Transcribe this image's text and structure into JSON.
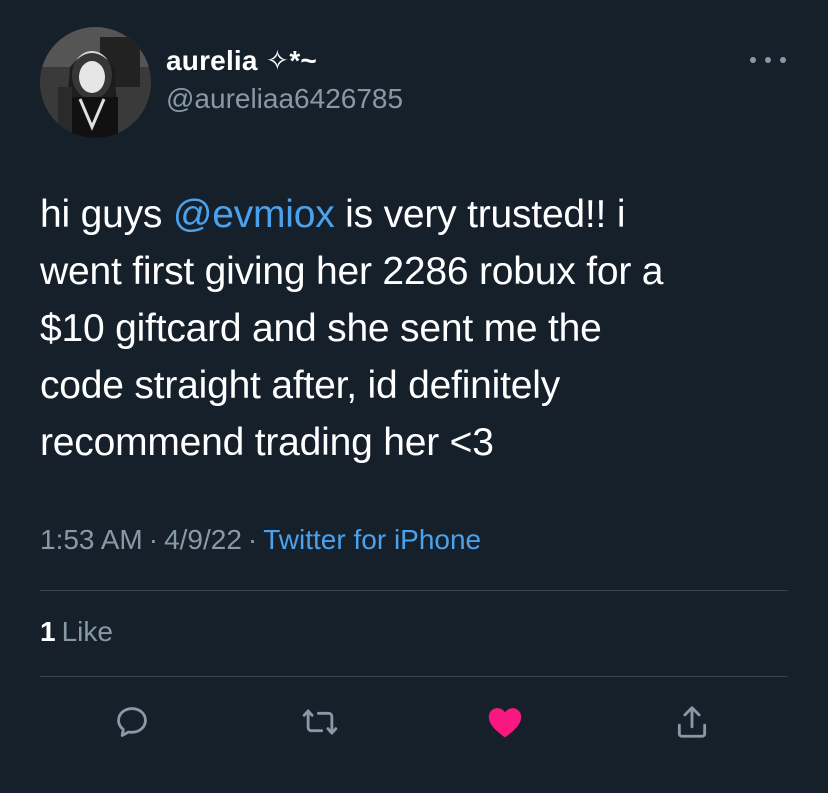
{
  "author": {
    "display_name": "aurelia ✧*~",
    "handle": "@aureliaa6426785"
  },
  "tweet": {
    "lines": [
      {
        "before": "hi guys ",
        "mention": "@evmiox",
        "after": " is very trusted!! i"
      },
      {
        "text": "went first giving her 2286 robux for a"
      },
      {
        "text": "$10 giftcard and she sent me the"
      },
      {
        "text": "code straight after, id definitely"
      },
      {
        "text": "recommend trading her <3"
      }
    ]
  },
  "meta": {
    "time": "1:53 AM",
    "separator": "·",
    "date": "4/9/22",
    "source": "Twitter for iPhone"
  },
  "engagement": {
    "like_count": "1",
    "like_label": "Like"
  },
  "actions": [
    "reply-icon",
    "retweet-icon",
    "like-icon",
    "share-icon"
  ],
  "colors": {
    "background": "#15202b",
    "secondary_text": "#8899a6",
    "link": "#4aa1ec",
    "like_active": "#f91880",
    "divider": "#38444d"
  }
}
